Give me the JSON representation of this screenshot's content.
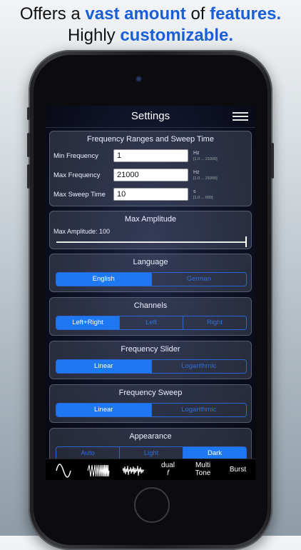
{
  "promo": {
    "line1_a": "Offers a ",
    "line1_b": "vast amount",
    "line1_c": " of ",
    "line1_d": "features.",
    "line2_a": "Highly ",
    "line2_b": "customizable."
  },
  "nav": {
    "title": "Settings",
    "menu_icon": "hamburger-menu-icon"
  },
  "frequency_card": {
    "title": "Frequency Ranges and Sweep Time",
    "rows": [
      {
        "label": "Min Frequency",
        "value": "1",
        "unit": "Hz",
        "range": "[1.0 ... 21000]"
      },
      {
        "label": "Max Frequency",
        "value": "21000",
        "unit": "Hz",
        "range": "[1.0 ... 21000]"
      },
      {
        "label": "Max Sweep Time",
        "value": "10",
        "unit": "s",
        "range": "[1.0 ... 600]"
      }
    ]
  },
  "amplitude_card": {
    "title": "Max Amplitude",
    "label": "Max Amplitude: 100",
    "slider_fraction": 1.0
  },
  "language_card": {
    "title": "Language",
    "options": [
      "English",
      "German"
    ],
    "selected": 0
  },
  "channels_card": {
    "title": "Channels",
    "options": [
      "Left+Right",
      "Left",
      "Right"
    ],
    "selected": 0
  },
  "slider_card": {
    "title": "Frequency Slider",
    "options": [
      "Linear",
      "Logarithmic"
    ],
    "selected": 0
  },
  "sweep_card": {
    "title": "Frequency Sweep",
    "options": [
      "Linear",
      "Logarithmic"
    ],
    "selected": 0
  },
  "appearance_card": {
    "title": "Appearance",
    "options": [
      "Auto",
      "Light",
      "Dark"
    ],
    "selected": 2
  },
  "toolbar": {
    "items": [
      {
        "icon": "sine-wave-icon"
      },
      {
        "icon": "sweep-wave-icon"
      },
      {
        "icon": "noise-wave-icon"
      },
      {
        "label_top": "dual",
        "label_bottom": "f"
      },
      {
        "label_top": "Multi",
        "label_bottom": "Tone"
      },
      {
        "label_top": "Burst"
      }
    ]
  },
  "colors": {
    "accent": "#1e78f2",
    "promo_blue": "#1a5fd6",
    "screen_bg": "#0d1022"
  }
}
